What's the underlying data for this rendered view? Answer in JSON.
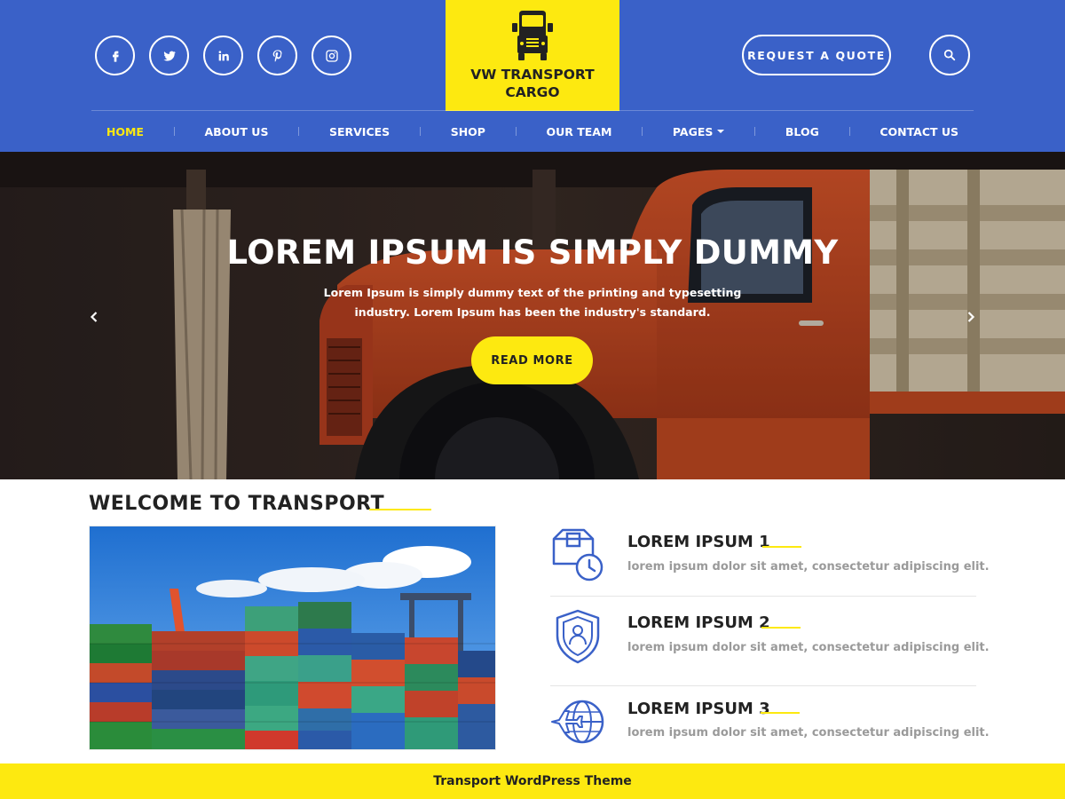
{
  "header": {
    "social": [
      {
        "name": "facebook-icon"
      },
      {
        "name": "twitter-icon"
      },
      {
        "name": "linkedin-icon"
      },
      {
        "name": "pinterest-icon"
      },
      {
        "name": "instagram-icon"
      }
    ],
    "logo_line1": "VW TRANSPORT",
    "logo_line2": "CARGO",
    "quote_label": "REQUEST A QUOTE",
    "search_icon": "search-icon"
  },
  "nav": {
    "items": [
      {
        "label": "HOME",
        "active": true
      },
      {
        "label": "ABOUT US"
      },
      {
        "label": "SERVICES"
      },
      {
        "label": "SHOP"
      },
      {
        "label": "OUR TEAM"
      },
      {
        "label": "PAGES",
        "dropdown": true
      },
      {
        "label": "BLOG"
      },
      {
        "label": "CONTACT US"
      }
    ]
  },
  "hero": {
    "title": "LOREM IPSUM IS SIMPLY DUMMY",
    "subtitle": "Lorem Ipsum is simply dummy text of the printing and typesetting industry. Lorem Ipsum has been the industry's standard.",
    "button": "READ MORE"
  },
  "welcome": {
    "title": "WELCOME TO TRANSPORT"
  },
  "features": [
    {
      "title": "LOREM IPSUM 1",
      "desc": "lorem ipsum dolor sit amet, consectetur adipiscing elit.",
      "icon": "package-clock-icon"
    },
    {
      "title": "LOREM IPSUM 2",
      "desc": "lorem ipsum dolor sit amet, consectetur adipiscing elit.",
      "icon": "shield-person-icon"
    },
    {
      "title": "LOREM IPSUM 3",
      "desc": "lorem ipsum dolor sit amet, consectetur adipiscing elit.",
      "icon": "plane-globe-icon"
    }
  ],
  "footer": {
    "label": "Transport WordPress Theme"
  },
  "colors": {
    "header_blue": "#3a61c8",
    "accent_yellow": "#fde910",
    "dark_text": "#222222",
    "muted_text": "#9a9a9a"
  }
}
